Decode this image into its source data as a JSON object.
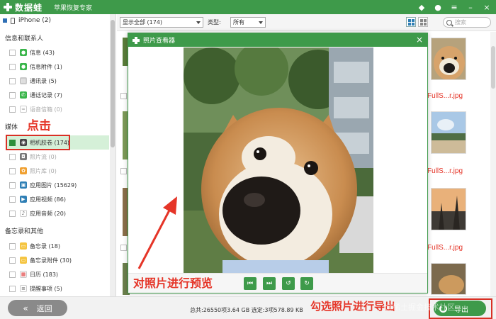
{
  "app": {
    "name": "数据蛙",
    "subtitle": "苹果恢复专家"
  },
  "sidebar": {
    "device": "iPhone (2)",
    "sections": [
      {
        "title": "信息和联系人",
        "items": [
          {
            "label": "信息 (43)",
            "dim": false
          },
          {
            "label": "信息附件 (1)",
            "dim": false
          },
          {
            "label": "通讯录 (5)",
            "dim": false
          },
          {
            "label": "通话记录 (7)",
            "dim": false
          },
          {
            "label": "语音信箱 (0)",
            "dim": true
          }
        ]
      },
      {
        "title": "媒体",
        "items": [
          {
            "label": "相机胶卷 (174)",
            "dim": false,
            "active": true
          },
          {
            "label": "照片流 (0)",
            "dim": true
          },
          {
            "label": "照片库 (0)",
            "dim": true
          },
          {
            "label": "应用图片 (15629)",
            "dim": false
          },
          {
            "label": "应用视频 (86)",
            "dim": false
          },
          {
            "label": "应用音频 (20)",
            "dim": false
          }
        ]
      },
      {
        "title": "备忘录和其他",
        "items": [
          {
            "label": "备忘录 (18)",
            "dim": false
          },
          {
            "label": "备忘录附件 (30)",
            "dim": false
          },
          {
            "label": "日历 (183)",
            "dim": false
          },
          {
            "label": "提醒事项 (5)",
            "dim": false
          }
        ]
      }
    ]
  },
  "toolbar": {
    "filter_value": "显示全部 (174)",
    "type_label": "类型:",
    "type_value": "所有",
    "search_placeholder": "搜索"
  },
  "content": {
    "filenames": [
      "FullS...r.jpg",
      "FullS...r.jpg",
      "FullS...r.jpg"
    ]
  },
  "viewer": {
    "title": "照片查看器",
    "close": "×"
  },
  "bottom": {
    "back_label": "返回",
    "stats": "总共:26550项3.64 GB 选定:3项578.89 KB",
    "export_label": "导出"
  },
  "annotations": {
    "click": "点击",
    "preview": "对照片进行预览",
    "select_export": "勾选照片进行导出",
    "watermark": "@稀土掘金技术社区"
  },
  "colors": {
    "brand_green": "#3e9a4a",
    "annotation_red": "#e53528"
  }
}
